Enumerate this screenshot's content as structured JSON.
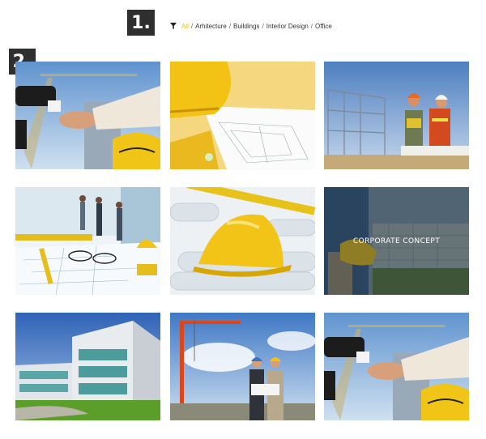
{
  "badges": {
    "first": "1.",
    "second": "2."
  },
  "filters": {
    "icon": "filter-funnel-icon",
    "separator": "/",
    "active_color": "#e9c21b",
    "items": [
      "All",
      "Arhitecture",
      "Buildings",
      "Interior Design",
      "Office"
    ]
  },
  "portfolio": {
    "items": [
      {
        "image": "handshake-crane-photo"
      },
      {
        "image": "hardhat-blueprint-photo"
      },
      {
        "image": "workers-on-site-photo"
      },
      {
        "image": "office-blueprint-glasses-photo"
      },
      {
        "image": "hardhat-on-rolled-plans-photo"
      },
      {
        "image": "worker-with-hardhat-photo",
        "overlay_title": "CORPORATE CONCEPT"
      },
      {
        "image": "modern-glass-building-photo"
      },
      {
        "image": "crane-and-businessmen-photo"
      },
      {
        "image": "handshake-crane-photo"
      }
    ]
  }
}
